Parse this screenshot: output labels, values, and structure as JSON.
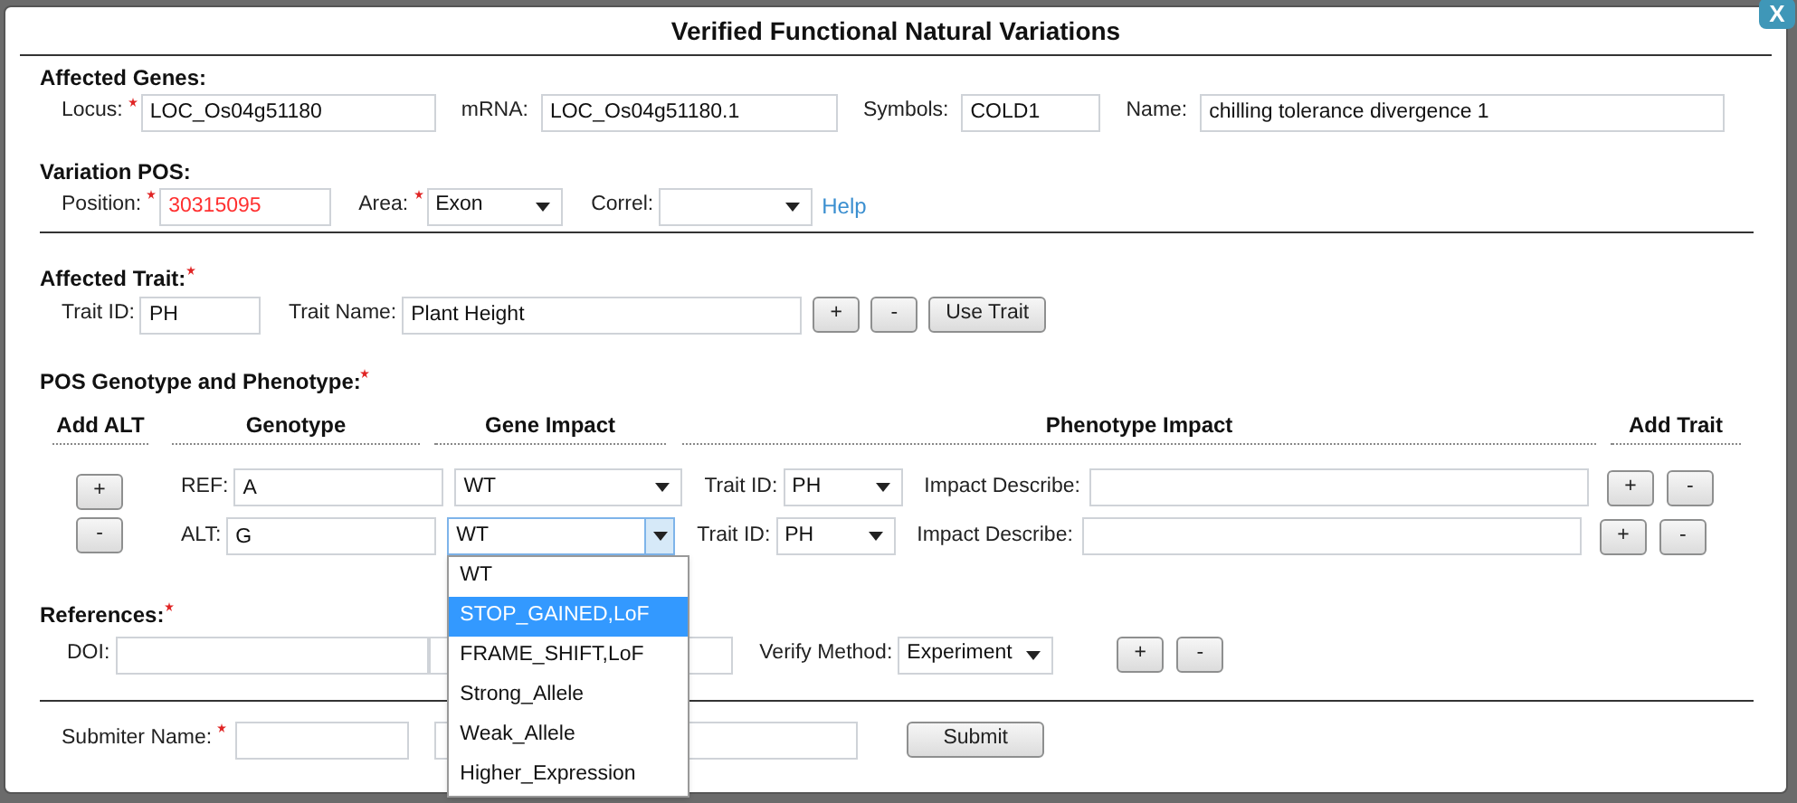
{
  "dialog": {
    "title": "Verified Functional Natural Variations",
    "close_button": "X"
  },
  "affected_genes": {
    "heading": "Affected Genes:",
    "fields": [
      {
        "label": "Locus:",
        "required": true,
        "value": "LOC_Os04g51180"
      },
      {
        "label": "mRNA:",
        "required": false,
        "value": "LOC_Os04g51180.1"
      },
      {
        "label": "Symbols:",
        "required": false,
        "value": "COLD1"
      },
      {
        "label": "Name:",
        "required": false,
        "value": "chilling tolerance divergence 1"
      }
    ]
  },
  "variation_pos": {
    "heading": "Variation POS:",
    "position": {
      "label": "Position:",
      "required": true,
      "value": "30315095",
      "error": true
    },
    "area": {
      "label": "Area:",
      "required": true,
      "value": "Exon"
    },
    "correl": {
      "label": "Correl:",
      "required": false
    },
    "help_link": "Help"
  },
  "affected_trait": {
    "heading": "Affected Trait:",
    "required": true,
    "trait_id": {
      "label": "Trait ID:",
      "value": "PH"
    },
    "trait_name": {
      "label": "Trait Name:",
      "value": "Plant Height"
    },
    "buttons": [
      "+",
      "-",
      "Use Trait"
    ]
  },
  "genotype_phenotype": {
    "heading": "POS Genotype and Phenotype:",
    "required": true,
    "columns": [
      "Add ALT",
      "Genotype",
      "Gene Impact",
      "Phenotype Impact",
      "Add Trait"
    ],
    "add_alt_buttons": [
      "+",
      "-"
    ],
    "rows": [
      {
        "label": "REF:",
        "genotype": "A",
        "gene_impact": "WT",
        "open": false,
        "trait_label": "Trait ID:",
        "trait_id": "PH",
        "impact_label": "Impact Describe:",
        "buttons": [
          "+",
          "-"
        ]
      },
      {
        "label": "ALT:",
        "genotype": "G",
        "gene_impact": "WT",
        "open": true,
        "trait_label": "Trait ID:",
        "trait_id": "PH",
        "impact_label": "Impact Describe:",
        "buttons": [
          "+",
          "-"
        ]
      }
    ],
    "open_dropdown": [
      {
        "label": "WT",
        "selected": false
      },
      {
        "label": "STOP_GAINED,LoF",
        "selected": true
      },
      {
        "label": "FRAME_SHIFT,LoF",
        "selected": false
      },
      {
        "label": "Strong_Allele",
        "selected": false
      },
      {
        "label": "Weak_Allele",
        "selected": false
      },
      {
        "label": "Higher_Expression",
        "selected": false
      }
    ]
  },
  "references": {
    "heading": "References:",
    "required": true,
    "doi_label": "DOI:",
    "verify_label": "Verify Method:",
    "verify_value": "Experiment",
    "buttons": [
      "+",
      "-"
    ]
  },
  "submitter": {
    "label": "Submiter Name:",
    "required": true,
    "submit_button": "Submit"
  }
}
